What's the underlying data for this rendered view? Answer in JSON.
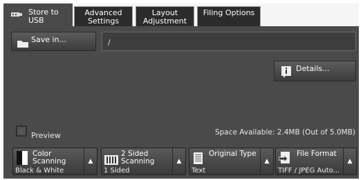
{
  "tabs": [
    {
      "line1": "Store to",
      "line2": "USB"
    },
    {
      "line1": "Advanced",
      "line2": "Settings"
    },
    {
      "line1": "Layout",
      "line2": "Adjustment"
    },
    {
      "line1": "Filing Options",
      "line2": ""
    }
  ],
  "save_in": {
    "label": "Save in...",
    "path": "/"
  },
  "details": {
    "label": "Details...",
    "icon": "info-icon"
  },
  "preview": {
    "label": "Preview",
    "checked": false
  },
  "space": "Space Available: 2.4MB (Out of 5.0MB)",
  "features": [
    {
      "title_line1": "Color",
      "title_line2": "Scanning",
      "value": "Black & White",
      "icon": "color-scan-icon"
    },
    {
      "title_line1": "2 Sided",
      "title_line2": "Scanning",
      "value": "1 Sided",
      "icon": "two-sided-icon"
    },
    {
      "title_line1": "Original Type",
      "title_line2": "",
      "value": "Text",
      "icon": "document-icon"
    },
    {
      "title_line1": "File Format",
      "title_line2": "",
      "value": "TIFF / JPEG Auto...",
      "icon": "file-format-icon"
    }
  ],
  "colors": {
    "panel": "#4a4a4a",
    "tab": "#2b2b2b"
  }
}
